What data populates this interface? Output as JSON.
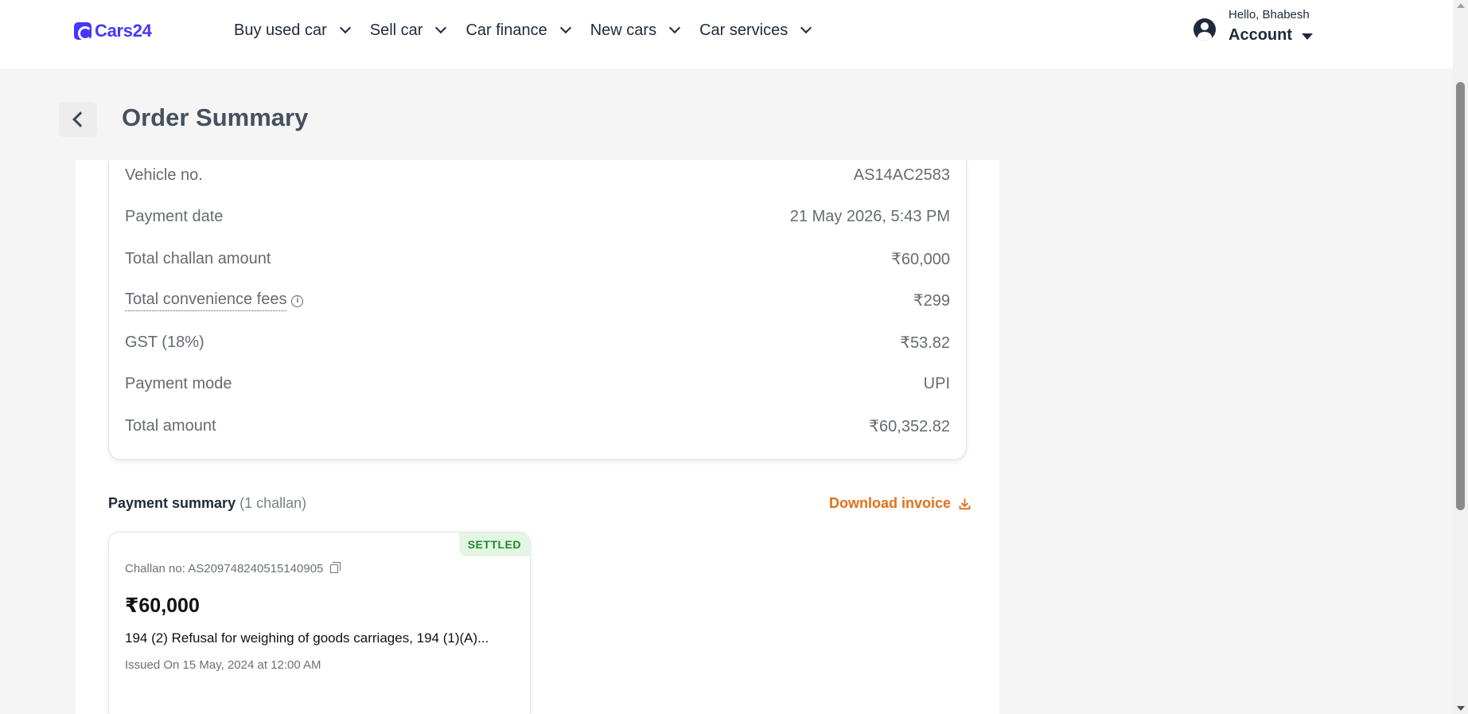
{
  "brand": {
    "name": "Cars24",
    "color": "#4736fe"
  },
  "nav": [
    {
      "label": "Buy used car"
    },
    {
      "label": "Sell car"
    },
    {
      "label": "Car finance"
    },
    {
      "label": "New cars"
    },
    {
      "label": "Car services"
    }
  ],
  "account": {
    "greeting": "Hello, Bhabesh",
    "label": "Account"
  },
  "page": {
    "title": "Order Summary"
  },
  "details": [
    {
      "label": "Vehicle no.",
      "value": "AS14AC2583"
    },
    {
      "label": "Payment date",
      "value": "21 May 2026, 5:43 PM"
    },
    {
      "label": "Total challan amount",
      "value": "₹60,000"
    },
    {
      "label": "Total convenience fees",
      "value": "₹299"
    },
    {
      "label": "GST (18%)",
      "value": "₹53.82"
    },
    {
      "label": "Payment mode",
      "value": "UPI"
    },
    {
      "label": "Total amount",
      "value": "₹60,352.82"
    }
  ],
  "payment_summary": {
    "title": "Payment summary",
    "count": "(1 challan)",
    "download_label": "Download invoice",
    "accent_color": "#e36f1a"
  },
  "challan": {
    "status": "SETTLED",
    "challan_no": "Challan no: AS209748240515140905",
    "amount": "₹60,000",
    "description": "194 (2) Refusal for weighing of goods carriages, 194 (1)(A)...",
    "issued": "Issued On 15 May, 2024 at 12:00 AM",
    "status_color": "#1e8a2b"
  }
}
